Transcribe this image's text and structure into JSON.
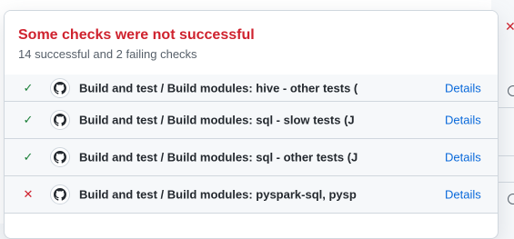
{
  "popover": {
    "title": "Some checks were not successful",
    "subtitle": "14 successful and 2 failing checks"
  },
  "checks": [
    {
      "status": "success",
      "icon": "check-icon",
      "name": "Build and test / Build modules: hive - other tests (",
      "details": "Details"
    },
    {
      "status": "success",
      "icon": "check-icon",
      "name": "Build and test / Build modules: sql - slow tests (J",
      "details": "Details"
    },
    {
      "status": "success",
      "icon": "check-icon",
      "name": "Build and test / Build modules: sql - other tests (J",
      "details": "Details"
    },
    {
      "status": "failure",
      "icon": "x-icon",
      "name": "Build and test / Build modules: pyspark-sql, pysp",
      "details": "Details"
    }
  ],
  "icons": {
    "success": "✓",
    "failure": "✕"
  },
  "colors": {
    "failure": "#cf222e",
    "success": "#1a7f37",
    "link": "#0969da"
  }
}
